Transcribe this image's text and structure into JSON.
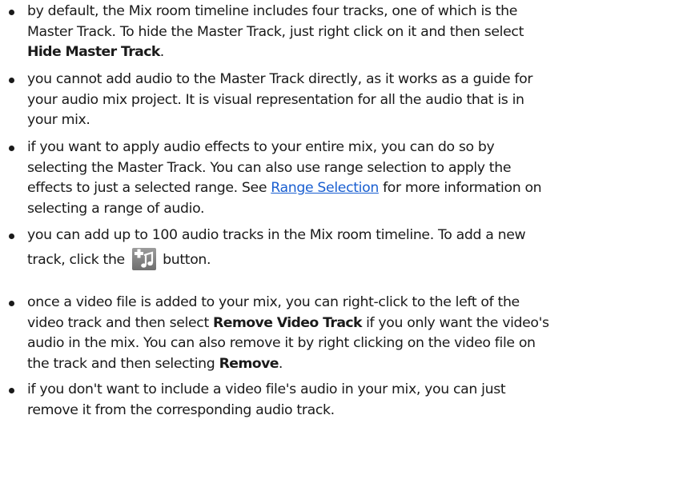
{
  "notes": [
    {
      "lines": [
        [
          {
            "t": "by default, the Mix room timeline includes four tracks, one of which is the"
          }
        ],
        [
          {
            "t": "Master Track. To hide the Master Track, just right click on it and then select"
          }
        ],
        [
          {
            "t": "Hide Master Track",
            "b": true
          },
          {
            "t": "."
          }
        ]
      ]
    },
    {
      "lines": [
        [
          {
            "t": "you cannot add audio to the Master Track directly, as it works as a guide for"
          }
        ],
        [
          {
            "t": "your audio mix project. It is visual representation for all the audio that is in"
          }
        ],
        [
          {
            "t": "your mix."
          }
        ]
      ]
    },
    {
      "lines": [
        [
          {
            "t": "if you want to apply audio effects to your entire mix, you can do so by"
          }
        ],
        [
          {
            "t": "selecting the Master Track. You can also use range selection to apply the"
          }
        ],
        [
          {
            "t": "effects to just a selected range. See "
          },
          {
            "t": "Range Selection",
            "link": true
          },
          {
            "t": " for more information on"
          }
        ],
        [
          {
            "t": "selecting a range of audio."
          }
        ]
      ]
    },
    {
      "lines": [
        [
          {
            "t": "you can add up to 100 audio tracks in the Mix room timeline. To add a new"
          }
        ],
        [
          {
            "t": "track, click the "
          },
          {
            "icon": "add-audio-track-icon"
          },
          {
            "t": " button."
          }
        ]
      ]
    },
    {
      "lines": [
        [
          {
            "t": "once a video file is added to your mix, you can right-click to the left of the"
          }
        ],
        [
          {
            "t": "video track and then select "
          },
          {
            "t": "Remove Video Track",
            "b": true
          },
          {
            "t": " if you only want the video's"
          }
        ],
        [
          {
            "t": "audio in the mix. You can also remove it by right clicking on the video file on"
          }
        ],
        [
          {
            "t": "the track and then selecting "
          },
          {
            "t": "Remove",
            "b": true
          },
          {
            "t": "."
          }
        ]
      ]
    },
    {
      "lines": [
        [
          {
            "t": "if you don't want to include a video file's audio in your mix, you can just"
          }
        ],
        [
          {
            "t": "remove it from the corresponding audio track."
          }
        ]
      ]
    }
  ]
}
